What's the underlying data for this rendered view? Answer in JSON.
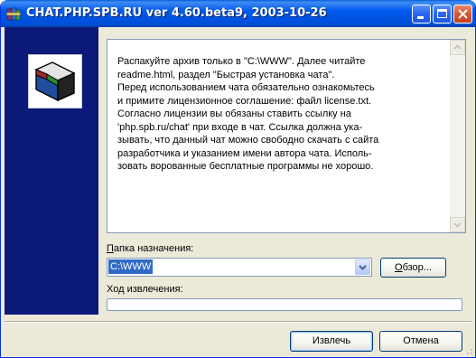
{
  "window": {
    "title": "CHAT.PHP.SPB.RU ver 4.60.beta9, 2003-10-26"
  },
  "info": {
    "text": "Распакуйте архив только в \"C:\\WWW\". Далее читайте\nreadme.html, раздел \"Быстрая установка чата\".\nПеред использованием чата обязательно ознакомьтесь\nи примите лицензионное соглашение: файл license.txt.\nСогласно лицензии вы обязаны ставить ссылку на\n'php.spb.ru/chat' при входе в чат. Ссылка должна ука-\nзывать, что данный чат можно свободно скачать с сайта\nразработчика и указанием имени автора чата. Исполь-\nзовать ворованные бесплатные программы не хорошо."
  },
  "destination": {
    "label_first": "П",
    "label_rest": "апка назначения:",
    "value": "C:\\WWW",
    "browse_first": "О",
    "browse_rest": "бзор..."
  },
  "progress": {
    "label": "Ход извлечения:",
    "fraction": 0
  },
  "buttons": {
    "extract": "Извлечь",
    "cancel": "Отмена"
  },
  "icons": {
    "app": "winrar-icon",
    "banner": "winrar-books-icon",
    "dropdown": "chevron-down-icon"
  },
  "colors": {
    "titlebar": "#0054e3",
    "banner": "#0b1a78",
    "selection": "#316ac5",
    "dialog": "#ece9d8"
  }
}
